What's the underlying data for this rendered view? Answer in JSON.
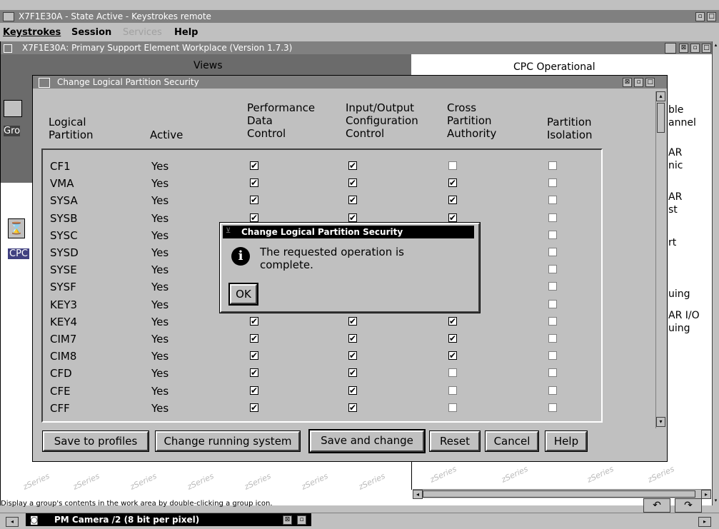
{
  "app": {
    "title": "X7F1E30A - State Active - Keystrokes remote",
    "menu": [
      "Keystrokes",
      "Session",
      "Services",
      "Help"
    ]
  },
  "workplace": {
    "title": "X7F1E30A: Primary Support Element Workplace (Version 1.7.3)",
    "views_label": "Views",
    "groups_label": "Gro",
    "cpc_label": "CPC",
    "cpc_operational_label": "CPC Operational",
    "right_fragments": [
      "ble",
      "annel",
      "AR",
      "nic",
      "AR",
      "st",
      "rt",
      "uing",
      "AR I/O",
      "uing"
    ],
    "status_text": "Display a group's contents in the work area by double-clicking a group icon."
  },
  "dialog": {
    "title": "Change Logical Partition Security",
    "columns": [
      {
        "lines": [
          "Logical",
          "Partition"
        ]
      },
      {
        "lines": [
          "Active"
        ]
      },
      {
        "lines": [
          "Performance",
          "Data",
          "Control"
        ]
      },
      {
        "lines": [
          "Input/Output",
          "Configuration",
          "Control"
        ]
      },
      {
        "lines": [
          "Cross",
          "Partition",
          "Authority"
        ]
      },
      {
        "lines": [
          "Partition",
          "Isolation"
        ]
      }
    ],
    "rows": [
      {
        "name": "CF1",
        "active": "Yes",
        "perf": true,
        "io": true,
        "cross": false,
        "iso": false
      },
      {
        "name": "VMA",
        "active": "Yes",
        "perf": true,
        "io": true,
        "cross": true,
        "iso": false
      },
      {
        "name": "SYSA",
        "active": "Yes",
        "perf": true,
        "io": true,
        "cross": true,
        "iso": false
      },
      {
        "name": "SYSB",
        "active": "Yes",
        "perf": true,
        "io": true,
        "cross": true,
        "iso": false
      },
      {
        "name": "SYSC",
        "active": "Yes",
        "perf": false,
        "io": false,
        "cross": false,
        "iso": false
      },
      {
        "name": "SYSD",
        "active": "Yes",
        "perf": false,
        "io": false,
        "cross": false,
        "iso": false
      },
      {
        "name": "SYSE",
        "active": "Yes",
        "perf": false,
        "io": false,
        "cross": false,
        "iso": false
      },
      {
        "name": "SYSF",
        "active": "Yes",
        "perf": false,
        "io": false,
        "cross": false,
        "iso": false
      },
      {
        "name": "KEY3",
        "active": "Yes",
        "perf": false,
        "io": false,
        "cross": false,
        "iso": false
      },
      {
        "name": "KEY4",
        "active": "Yes",
        "perf": true,
        "io": true,
        "cross": true,
        "iso": false
      },
      {
        "name": "CIM7",
        "active": "Yes",
        "perf": true,
        "io": true,
        "cross": true,
        "iso": false
      },
      {
        "name": "CIM8",
        "active": "Yes",
        "perf": true,
        "io": true,
        "cross": true,
        "iso": false
      },
      {
        "name": "CFD",
        "active": "Yes",
        "perf": true,
        "io": true,
        "cross": false,
        "iso": false
      },
      {
        "name": "CFE",
        "active": "Yes",
        "perf": true,
        "io": true,
        "cross": false,
        "iso": false
      },
      {
        "name": "CFF",
        "active": "Yes",
        "perf": true,
        "io": true,
        "cross": false,
        "iso": false
      }
    ],
    "buttons": {
      "save_profiles": "Save to profiles",
      "change_running": "Change running system",
      "save_change": "Save and change",
      "reset": "Reset",
      "cancel": "Cancel",
      "help": "Help"
    }
  },
  "message": {
    "title": "Change Logical Partition Security",
    "text_line1": "The requested operation is",
    "text_line2": "complete.",
    "ok": "OK"
  },
  "camera": {
    "title": "PM Camera /2  (8 bit per pixel)"
  },
  "watermark": "zSeries"
}
